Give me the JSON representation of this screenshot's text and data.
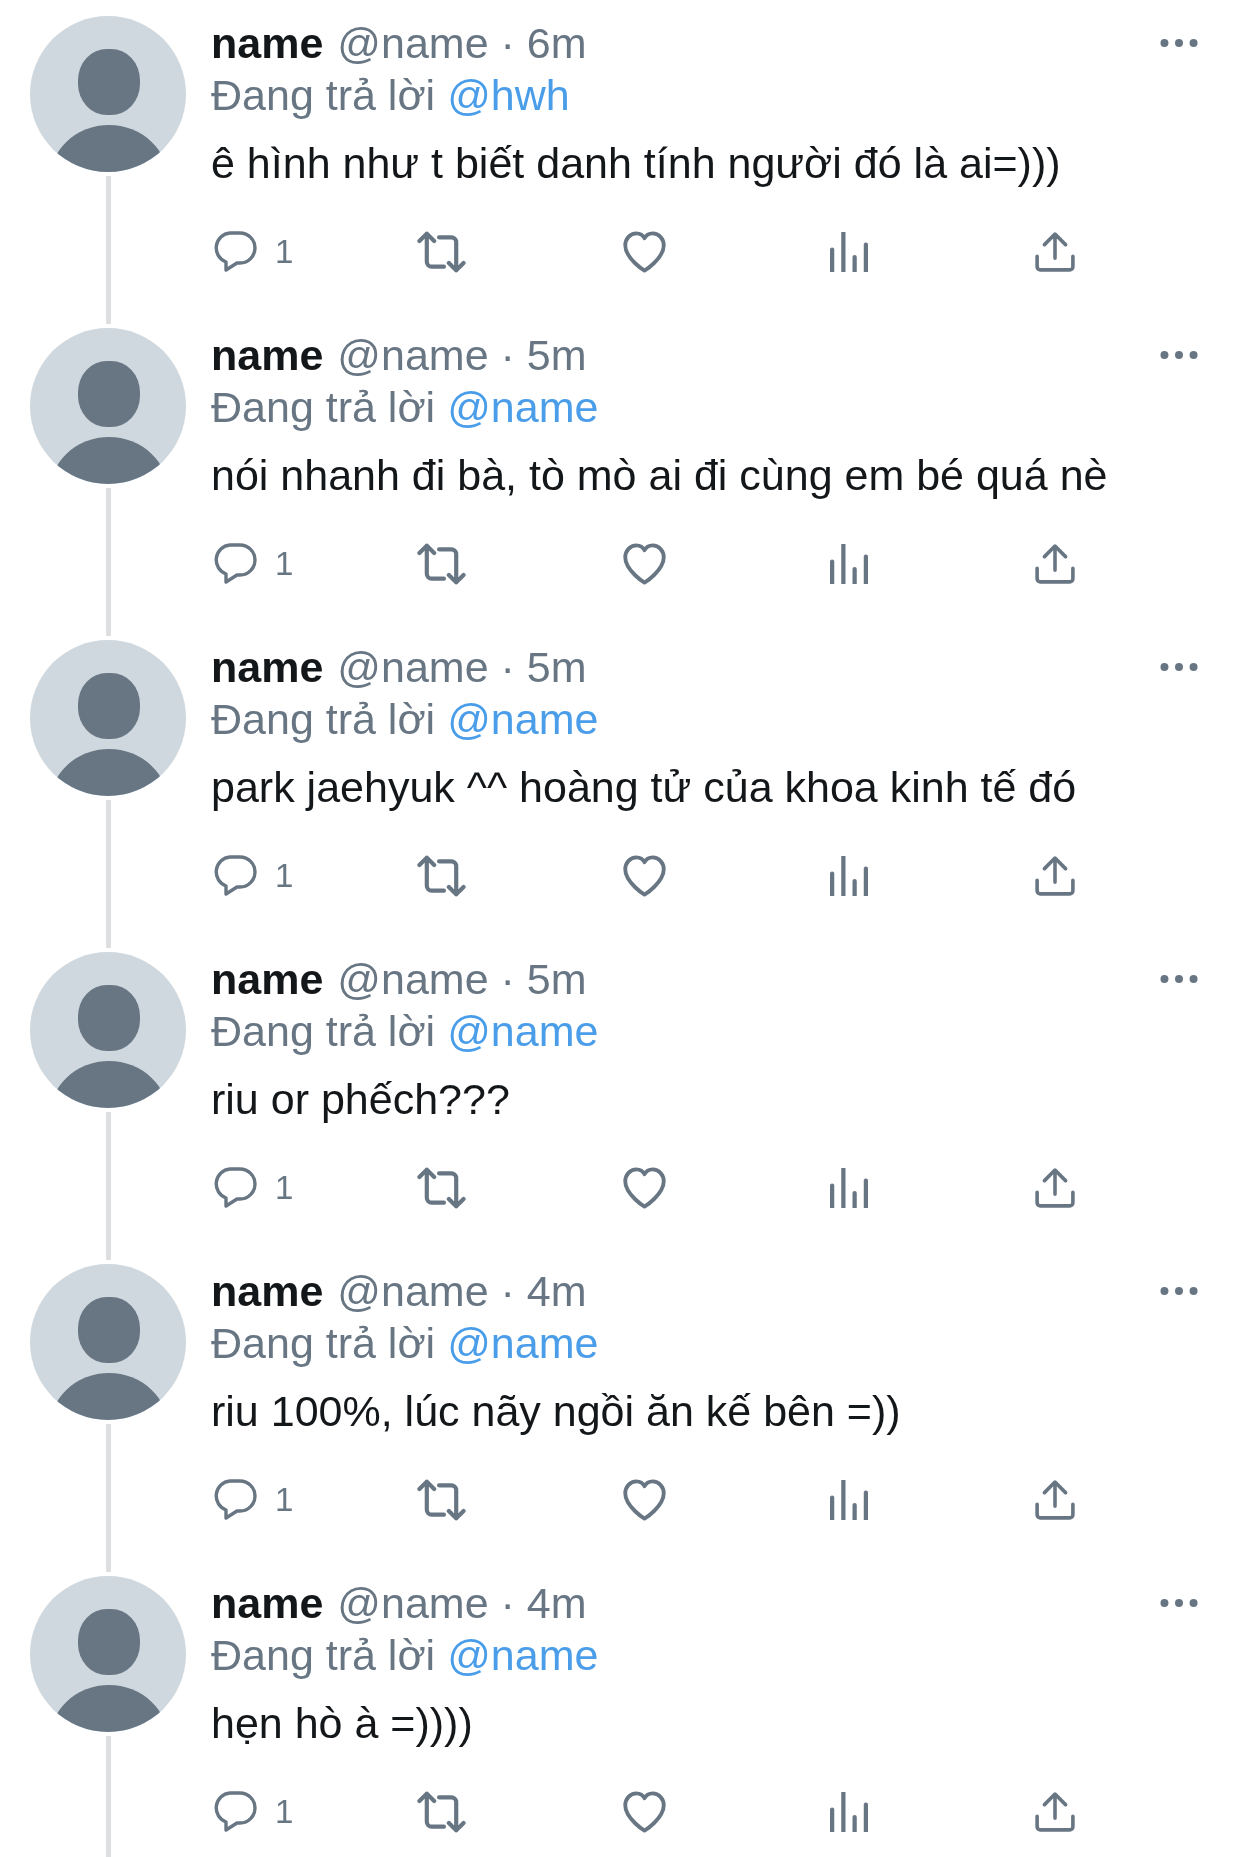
{
  "replies": [
    {
      "name": "name",
      "meta": "@name · 6m",
      "reply_label": "Đang trả lời",
      "reply_to": "@hwh",
      "text": "ê hình như t biết danh tính người đó là ai=)))",
      "reply_count": "1"
    },
    {
      "name": "name",
      "meta": "@name · 5m",
      "reply_label": "Đang trả lời",
      "reply_to": "@name",
      "text": "nói nhanh đi bà, tò mò ai đi cùng em bé quá nè",
      "reply_count": "1"
    },
    {
      "name": "name",
      "meta": "@name · 5m",
      "reply_label": "Đang trả lời",
      "reply_to": "@name",
      "text": "park jaehyuk ^^ hoàng tử của khoa kinh tế đó",
      "reply_count": "1"
    },
    {
      "name": "name",
      "meta": "@name · 5m",
      "reply_label": "Đang trả lời",
      "reply_to": "@name",
      "text": "riu or phếch???",
      "reply_count": "1"
    },
    {
      "name": "name",
      "meta": "@name · 4m",
      "reply_label": "Đang trả lời",
      "reply_to": "@name",
      "text": "riu 100%, lúc nãy ngồi ăn kế bên =))",
      "reply_count": "1"
    },
    {
      "name": "name",
      "meta": "@name · 4m",
      "reply_label": "Đang trả lời",
      "reply_to": "@name",
      "text": "hẹn hò à =))))",
      "reply_count": "1"
    }
  ]
}
